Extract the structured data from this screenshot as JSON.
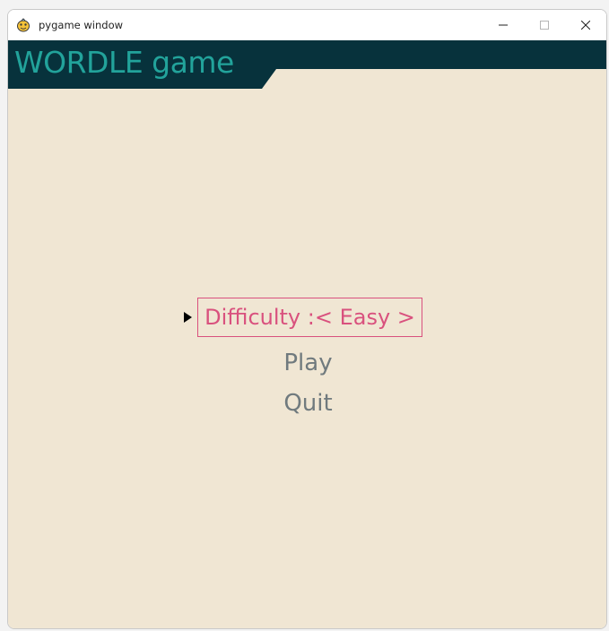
{
  "window": {
    "title": "pygame window",
    "icon": "pygame-snake-icon",
    "controls": [
      "minimize-icon",
      "maximize-icon",
      "close-icon"
    ]
  },
  "header": {
    "title": "WORDLE game"
  },
  "menu": {
    "selector_icon": "triangle-right-icon",
    "items": [
      {
        "label": "Difficulty :< Easy >",
        "selected": true
      },
      {
        "label": "Play",
        "selected": false
      },
      {
        "label": "Quit",
        "selected": false
      }
    ]
  },
  "colors": {
    "background": "#f0e6d3",
    "header_band": "#07323c",
    "header_text": "#22a39b",
    "selected_text": "#d9517e",
    "menu_text": "#707a7e"
  }
}
